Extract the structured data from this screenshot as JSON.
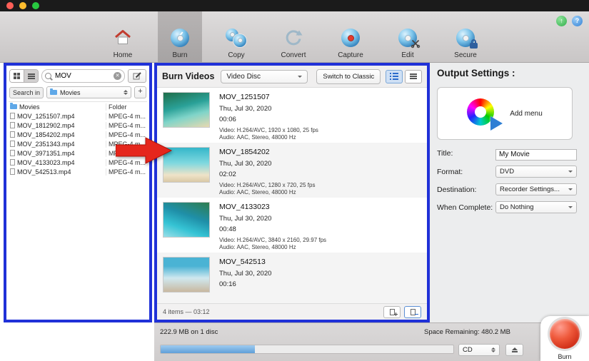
{
  "window": {
    "upgrade_glyph": "↑",
    "help_glyph": "?"
  },
  "toolbar": {
    "items": [
      {
        "label": "Home",
        "selected": false
      },
      {
        "label": "Burn",
        "selected": true
      },
      {
        "label": "Copy",
        "selected": false
      },
      {
        "label": "Convert",
        "selected": false
      },
      {
        "label": "Capture",
        "selected": false
      },
      {
        "label": "Edit",
        "selected": false
      },
      {
        "label": "Secure",
        "selected": false
      }
    ]
  },
  "browser": {
    "search_value": "MOV",
    "clear_glyph": "✕",
    "search_in_label": "Search in",
    "location": "Movies",
    "add_label": "+",
    "rows": [
      {
        "name": "Movies",
        "type": "Folder",
        "is_folder": true
      },
      {
        "name": "MOV_1251507.mp4",
        "type": "MPEG-4 m...",
        "is_file": true
      },
      {
        "name": "MOV_1812902.mp4",
        "type": "MPEG-4 m...",
        "is_file": true
      },
      {
        "name": "MOV_1854202.mp4",
        "type": "MPEG-4 m...",
        "is_file": true
      },
      {
        "name": "MOV_2351343.mp4",
        "type": "MPEG-4 m...",
        "is_file": true
      },
      {
        "name": "MOV_3971351.mp4",
        "type": "MPEG-4 m...",
        "is_file": true
      },
      {
        "name": "MOV_4133023.mp4",
        "type": "MPEG-4 m...",
        "is_file": true
      },
      {
        "name": "MOV_542513.mp4",
        "type": "MPEG-4 m...",
        "is_file": true
      }
    ]
  },
  "burn_panel": {
    "title": "Burn Videos",
    "disc_type": "Video Disc",
    "switch_label": "Switch to Classic",
    "videos": [
      {
        "name": "MOV_1251507",
        "date": "Thu, Jul 30, 2020",
        "duration": "00:06",
        "video_info": "Video: H.264/AVC, 1920 x 1080, 25 fps",
        "audio_info": "Audio: AAC, Stereo, 48000 Hz"
      },
      {
        "name": "MOV_1854202",
        "date": "Thu, Jul 30, 2020",
        "duration": "02:02",
        "video_info": "Video: H.264/AVC, 1280 x 720, 25 fps",
        "audio_info": "Audio: AAC, Stereo, 48000 Hz"
      },
      {
        "name": "MOV_4133023",
        "date": "Thu, Jul 30, 2020",
        "duration": "00:48",
        "video_info": "Video: H.264/AVC, 3840 x 2160, 29.97 fps",
        "audio_info": "Audio: AAC, Stereo, 48000 Hz"
      },
      {
        "name": "MOV_542513",
        "date": "Thu, Jul 30, 2020",
        "duration": "00:16"
      }
    ],
    "footer_summary": "4 items — 03:12"
  },
  "output": {
    "heading": "Output Settings :",
    "add_menu_label": "Add menu",
    "title_label": "Title:",
    "title_value": "My Movie",
    "format_label": "Format:",
    "format_value": "DVD",
    "destination_label": "Destination:",
    "destination_value": "Recorder Settings...",
    "complete_label": "When Complete:",
    "complete_value": "Do Nothing"
  },
  "bottom": {
    "usage": "222.9 MB on 1 disc",
    "space_remaining": "Space Remaining: 480.2 MB",
    "disc": "CD",
    "burn_label": "Burn"
  }
}
